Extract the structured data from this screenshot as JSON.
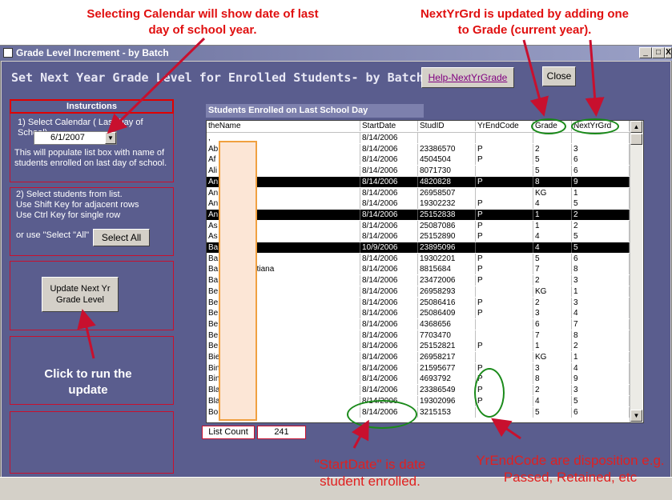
{
  "annotations": {
    "calendar_note": "Selecting Calendar will show date of last day of school year.",
    "nextyrgrd_note": "NextYrGrd is updated by adding one to Grade (current year).",
    "click_note": "Click to run the update",
    "startdate_note": "\"StartDate\" is date student enrolled.",
    "yrendcode_note": "YrEndCode are disposition e.g. Passed, Retained, etc"
  },
  "window": {
    "title": "Grade Level Increment -  by Batch",
    "controls": [
      "_",
      "□",
      "X"
    ]
  },
  "form": {
    "headline": "Set Next Year Grade Level for Enrolled Students-  by Batch",
    "help_label": "Help-NextYrGrade",
    "close_label": "Close"
  },
  "instructions": {
    "title": "Insturctions",
    "step1": "1)  Select Calendar ( Last Day of School)",
    "date_value": "6/1/2007",
    "step1_note": "This will populate list box with name of students enrolled on last day of school.",
    "step2_line1": "2)  Select students from list.",
    "step2_line2": "Use Shift Key for adjacent rows",
    "step2_line3": "Use Ctrl Key for single row",
    "step2_line4": "or use \"Select \"All\"",
    "select_all_label": "Select All",
    "update_label": "Update Next Yr Grade Level"
  },
  "list": {
    "header": "Students Enrolled on Last School Day",
    "columns": [
      "theName",
      "StartDate",
      "StudID",
      "YrEndCode",
      "Grade",
      "NextYrGrd"
    ],
    "rows": [
      {
        "name": ",",
        "start": "8/14/2006",
        "id": "",
        "code": "",
        "grade": "",
        "next": "",
        "sel": false
      },
      {
        "name": "Ab        nteha",
        "start": "8/14/2006",
        "id": "23386570",
        "code": "P",
        "grade": "2",
        "next": "3",
        "sel": false
      },
      {
        "name": "Af",
        "start": "8/14/2006",
        "id": "4504504",
        "code": "P",
        "grade": "5",
        "next": "6",
        "sel": false
      },
      {
        "name": "Ali",
        "start": "8/14/2006",
        "id": "8071730",
        "code": "",
        "grade": "5",
        "next": "6",
        "sel": false
      },
      {
        "name": "An          hn",
        "start": "8/14/2006",
        "id": "4820828",
        "code": "P",
        "grade": "8",
        "next": "9",
        "sel": true
      },
      {
        "name": "An          abella",
        "start": "8/14/2006",
        "id": "26958507",
        "code": "",
        "grade": "KG",
        "next": "1",
        "sel": false
      },
      {
        "name": "An          regxxx",
        "start": "8/14/2006",
        "id": "19302232",
        "code": "P",
        "grade": "4",
        "next": "5",
        "sel": false
      },
      {
        "name": "An          an",
        "start": "8/14/2006",
        "id": "25152838",
        "code": "P",
        "grade": "1",
        "next": "2",
        "sel": true
      },
      {
        "name": "As",
        "start": "8/14/2006",
        "id": "25087086",
        "code": "P",
        "grade": "1",
        "next": "2",
        "sel": false
      },
      {
        "name": "As",
        "start": "8/14/2006",
        "id": "25152890",
        "code": "P",
        "grade": "4",
        "next": "5",
        "sel": false
      },
      {
        "name": "Ba          randeep",
        "start": "10/9/2006",
        "id": "23895096",
        "code": "",
        "grade": "4",
        "next": "5",
        "sel": true
      },
      {
        "name": "Ba          Sarah",
        "start": "8/14/2006",
        "id": "19302201",
        "code": "P",
        "grade": "5",
        "next": "6",
        "sel": false
      },
      {
        "name": "Ba          urst, Christiana",
        "start": "8/14/2006",
        "id": "8815684",
        "code": "P",
        "grade": "7",
        "next": "8",
        "sel": false
      },
      {
        "name": "Ba          , Olivia",
        "start": "8/14/2006",
        "id": "23472006",
        "code": "P",
        "grade": "2",
        "next": "3",
        "sel": false
      },
      {
        "name": "Be",
        "start": "8/14/2006",
        "id": "26958293",
        "code": "",
        "grade": "KG",
        "next": "1",
        "sel": false
      },
      {
        "name": "Be          y",
        "start": "8/14/2006",
        "id": "25086416",
        "code": "P",
        "grade": "2",
        "next": "3",
        "sel": false
      },
      {
        "name": "Be          y",
        "start": "8/14/2006",
        "id": "25086409",
        "code": "P",
        "grade": "3",
        "next": "4",
        "sel": false
      },
      {
        "name": "Be",
        "start": "8/14/2006",
        "id": "4368656",
        "code": "",
        "grade": "6",
        "next": "7",
        "sel": false
      },
      {
        "name": "Be",
        "start": "8/14/2006",
        "id": "7703470",
        "code": "",
        "grade": "7",
        "next": "8",
        "sel": false
      },
      {
        "name": "Be          e",
        "start": "8/14/2006",
        "id": "25152821",
        "code": "P",
        "grade": "1",
        "next": "2",
        "sel": false
      },
      {
        "name": "Bie          ie",
        "start": "8/14/2006",
        "id": "26958217",
        "code": "",
        "grade": "KG",
        "next": "1",
        "sel": false
      },
      {
        "name": "Bin",
        "start": "8/14/2006",
        "id": "21595677",
        "code": "P",
        "grade": "3",
        "next": "4",
        "sel": false
      },
      {
        "name": "Bin          sie",
        "start": "8/14/2006",
        "id": "4693792",
        "code": "P",
        "grade": "8",
        "next": "9",
        "sel": false
      },
      {
        "name": "Bla",
        "start": "8/14/2006",
        "id": "23386549",
        "code": "P",
        "grade": "2",
        "next": "3",
        "sel": false
      },
      {
        "name": "Bla          h",
        "start": "8/14/2006",
        "id": "19302096",
        "code": "P",
        "grade": "4",
        "next": "5",
        "sel": false
      },
      {
        "name": "Bo          icia",
        "start": "8/14/2006",
        "id": "3215153",
        "code": "",
        "grade": "5",
        "next": "6",
        "sel": false
      }
    ],
    "count_label": "List Count",
    "count_value": "241"
  },
  "colors": {
    "form_bg": "#5a5d8e",
    "annotation_red": "#e01010",
    "highlight_green": "#1a8a1a"
  }
}
